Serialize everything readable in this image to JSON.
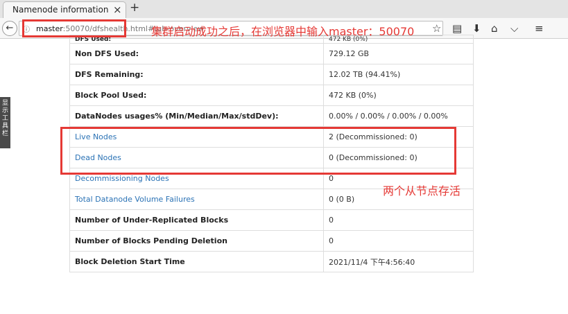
{
  "browser": {
    "tab_title": "Namenode information",
    "tab_close": "×",
    "new_tab": "+",
    "url_host": "master",
    "url_rest": ":50070/dfshealth.html#tab-overview",
    "back_icon": "arrow-left-icon",
    "toolbar_icons": [
      "star-icon",
      "reading-list-icon",
      "download-icon",
      "home-icon",
      "pocket-icon",
      "menu-icon"
    ]
  },
  "sidebar_tab": {
    "chars": [
      "显",
      "示",
      "工",
      "具",
      "栏"
    ]
  },
  "annotations": {
    "top_note": "集群启动成功之后，在浏览器中输入master：50070",
    "nodes_note": "两个从节点存活",
    "highlight_color": "#e53935"
  },
  "table": {
    "partial_row": {
      "label": "DFS Used:",
      "value": "472 KB (0%)"
    },
    "rows": [
      {
        "label": "Non DFS Used:",
        "value": "729.12 GB",
        "link": false
      },
      {
        "label": "DFS Remaining:",
        "value": "12.02 TB (94.41%)",
        "link": false
      },
      {
        "label": "Block Pool Used:",
        "value": "472 KB (0%)",
        "link": false
      },
      {
        "label": "DataNodes usages% (Min/Median/Max/stdDev):",
        "value": "0.00% / 0.00% / 0.00% / 0.00%",
        "link": false
      },
      {
        "label": "Live Nodes",
        "value": "2 (Decommissioned: 0)",
        "link": true
      },
      {
        "label": "Dead Nodes",
        "value": "0 (Decommissioned: 0)",
        "link": true
      },
      {
        "label": "Decommissioning Nodes",
        "value": "0",
        "link": true
      },
      {
        "label": "Total Datanode Volume Failures",
        "value": "0 (0 B)",
        "link": true
      },
      {
        "label": "Number of Under-Replicated Blocks",
        "value": "0",
        "link": false
      },
      {
        "label": "Number of Blocks Pending Deletion",
        "value": "0",
        "link": false
      },
      {
        "label": "Block Deletion Start Time",
        "value": "2021/11/4 下午4:56:40",
        "link": false
      }
    ]
  }
}
